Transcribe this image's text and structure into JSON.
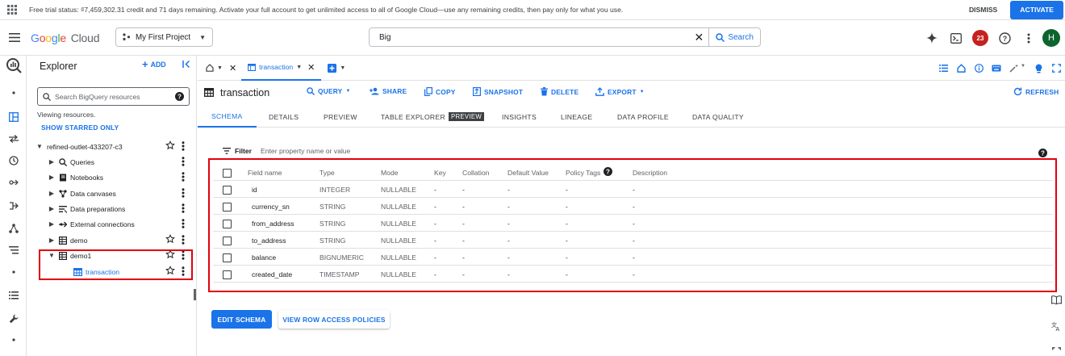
{
  "colors": {
    "accent": "#1a73e8",
    "highlight": "#e3000f",
    "badge": "#c5221f",
    "avatar": "#0d652d"
  },
  "banner": {
    "text": "Free trial status: ₫7,459,302.31 credit and 71 days remaining. Activate your full account to get unlimited access to all of Google Cloud—use any remaining credits, then pay only for what you use.",
    "dismiss": "DISMISS",
    "activate": "ACTIVATE"
  },
  "header": {
    "logo_google": [
      "G",
      "o",
      "o",
      "g",
      "l",
      "e"
    ],
    "logo_cloud": "Cloud",
    "project": "My First Project",
    "search_value": "Big",
    "search_button": "Search",
    "notifications": "23",
    "avatar_letter": "H"
  },
  "explorer": {
    "title": "Explorer",
    "add": "ADD",
    "search_placeholder": "Search BigQuery resources",
    "viewing": "Viewing resources.",
    "show_starred": "SHOW STARRED ONLY",
    "project": "refined-outlet-433207-c3",
    "items": [
      {
        "label": "Queries",
        "icon": "search-icon"
      },
      {
        "label": "Notebooks",
        "icon": "notebook-icon"
      },
      {
        "label": "Data canvases",
        "icon": "canvas-icon"
      },
      {
        "label": "Data preparations",
        "icon": "data-prep-icon"
      },
      {
        "label": "External connections",
        "icon": "connection-icon"
      },
      {
        "label": "demo",
        "icon": "dataset-icon"
      },
      {
        "label": "demo1",
        "icon": "dataset-icon"
      },
      {
        "label": "transaction",
        "icon": "table-icon"
      }
    ]
  },
  "tabs": {
    "resource_tab": "transaction"
  },
  "toolbar": {
    "title": "transaction",
    "query": "QUERY",
    "share": "SHARE",
    "copy": "COPY",
    "snapshot": "SNAPSHOT",
    "delete": "DELETE",
    "export": "EXPORT",
    "refresh": "REFRESH"
  },
  "subtabs": {
    "schema": "SCHEMA",
    "details": "DETAILS",
    "preview": "PREVIEW",
    "table_explorer": "TABLE EXPLORER",
    "preview_tag": "PREVIEW",
    "insights": "INSIGHTS",
    "lineage": "LINEAGE",
    "data_profile": "DATA PROFILE",
    "data_quality": "DATA QUALITY"
  },
  "filter": {
    "label": "Filter",
    "placeholder": "Enter property name or value"
  },
  "schema": {
    "headers": [
      "Field name",
      "Type",
      "Mode",
      "Key",
      "Collation",
      "Default Value",
      "Policy Tags",
      "Description"
    ],
    "rows": [
      [
        "id",
        "INTEGER",
        "NULLABLE",
        "-",
        "-",
        "-",
        "-",
        "-"
      ],
      [
        "currency_sn",
        "STRING",
        "NULLABLE",
        "-",
        "-",
        "-",
        "-",
        "-"
      ],
      [
        "from_address",
        "STRING",
        "NULLABLE",
        "-",
        "-",
        "-",
        "-",
        "-"
      ],
      [
        "to_address",
        "STRING",
        "NULLABLE",
        "-",
        "-",
        "-",
        "-",
        "-"
      ],
      [
        "balance",
        "BIGNUMERIC",
        "NULLABLE",
        "-",
        "-",
        "-",
        "-",
        "-"
      ],
      [
        "created_date",
        "TIMESTAMP",
        "NULLABLE",
        "-",
        "-",
        "-",
        "-",
        "-"
      ]
    ]
  },
  "buttons": {
    "edit_schema": "EDIT SCHEMA",
    "row_access": "VIEW ROW ACCESS POLICIES"
  }
}
